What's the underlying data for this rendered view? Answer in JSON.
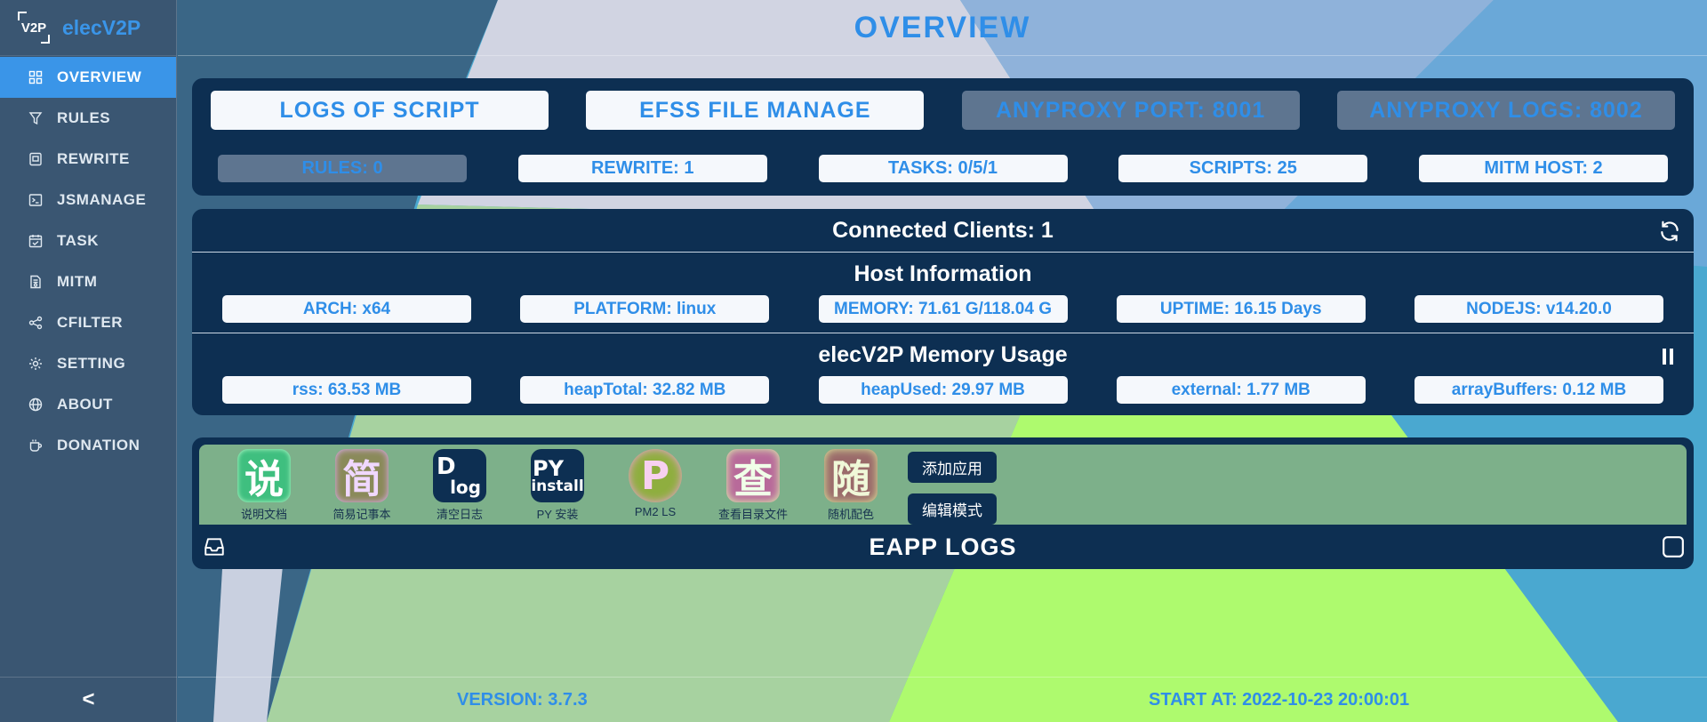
{
  "brand": {
    "logo_text": "V2P",
    "name": "elecV2P"
  },
  "sidebar": {
    "items": [
      {
        "label": "OVERVIEW",
        "icon": "grid-icon",
        "active": true
      },
      {
        "label": "RULES",
        "icon": "filter-icon"
      },
      {
        "label": "REWRITE",
        "icon": "rewrite-icon"
      },
      {
        "label": "JSMANAGE",
        "icon": "terminal-icon"
      },
      {
        "label": "TASK",
        "icon": "calendar-icon"
      },
      {
        "label": "MITM",
        "icon": "certificate-icon"
      },
      {
        "label": "CFILTER",
        "icon": "share-icon"
      },
      {
        "label": "SETTING",
        "icon": "gear-icon"
      },
      {
        "label": "ABOUT",
        "icon": "globe-icon"
      },
      {
        "label": "DONATION",
        "icon": "cup-icon"
      }
    ],
    "collapse_label": "<"
  },
  "header": {
    "title": "OVERVIEW"
  },
  "top_buttons": [
    "LOGS OF SCRIPT",
    "EFSS FILE MANAGE",
    "ANYPROXY PORT: 8001",
    "ANYPROXY LOGS: 8002"
  ],
  "stats": [
    "RULES: 0",
    "REWRITE: 1",
    "TASKS: 0/5/1",
    "SCRIPTS: 25",
    "MITM HOST: 2"
  ],
  "clients": {
    "title": "Connected Clients: 1"
  },
  "host_info": {
    "title": "Host Information",
    "items": [
      "ARCH: x64",
      "PLATFORM: linux",
      "MEMORY: 71.61 G/118.04 G",
      "UPTIME: 16.15 Days",
      "NODEJS: v14.20.0"
    ]
  },
  "memory_usage": {
    "title": "elecV2P Memory Usage",
    "items": [
      "rss: 63.53 MB",
      "heapTotal: 32.82 MB",
      "heapUsed: 29.97 MB",
      "external: 1.77 MB",
      "arrayBuffers: 0.12 MB"
    ]
  },
  "apps": [
    {
      "glyph": "说",
      "label": "说明文档",
      "bg": "#3fbf7f",
      "fg": "#ffffff"
    },
    {
      "glyph": "简",
      "label": "简易记事本",
      "bg": "#8a8a5a",
      "fg": "#f0d8ff"
    },
    {
      "glyph_top": "D",
      "glyph_bottom": "log",
      "label": "清空日志",
      "bg": "#0d2f52",
      "fg": "#ffffff"
    },
    {
      "glyph_top": "PY",
      "glyph_bottom": "install",
      "label": "PY 安装",
      "bg": "#0d2f52",
      "fg": "#ffffff"
    },
    {
      "glyph": "P",
      "label": "PM2 LS",
      "bg": "#8fae3f",
      "fg": "#f7d0f0"
    },
    {
      "glyph": "查",
      "label": "查看目录文件",
      "bg": "#b86a9a",
      "fg": "#f0ffe8"
    },
    {
      "glyph": "随",
      "label": "随机配色",
      "bg": "#9a6a6a",
      "fg": "#f0f8d8"
    }
  ],
  "app_buttons": {
    "add": "添加应用",
    "edit": "编辑模式"
  },
  "eapp_logs": {
    "title": "EAPP LOGS"
  },
  "footer": {
    "version": "VERSION: 3.7.3",
    "start": "START AT: 2022-10-23 20:00:01"
  }
}
